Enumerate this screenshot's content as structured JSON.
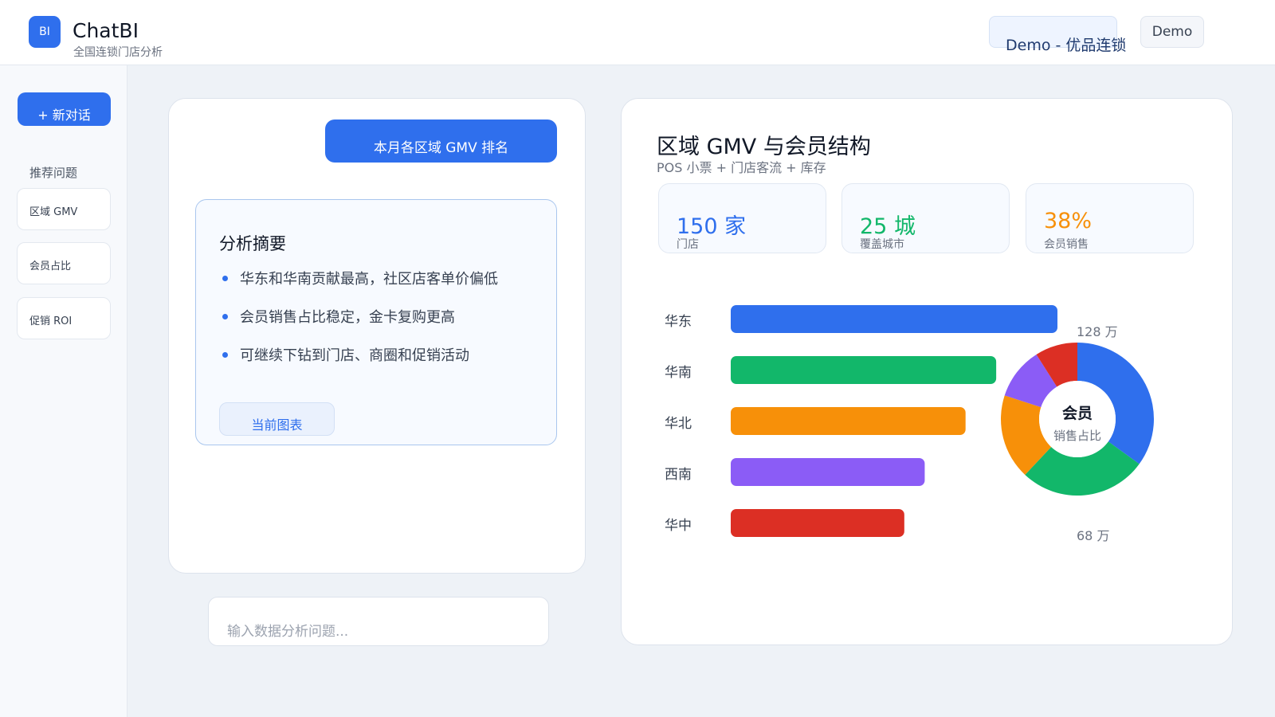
{
  "header": {
    "logo_text": "BI",
    "app_title": "ChatBI",
    "app_subtitle": "全国连锁门店分析",
    "tenant_label": "Demo - 优品连锁",
    "demo_button": "Demo"
  },
  "sidebar": {
    "new_chat_label": "+ 新对话",
    "section_label": "推荐问题",
    "items": [
      {
        "label": "区域 GMV"
      },
      {
        "label": "会员占比"
      },
      {
        "label": "促销 ROI"
      }
    ]
  },
  "chat": {
    "user_message": "本月各区域 GMV 排名",
    "summary_title": "分析摘要",
    "summary_items": [
      "华东和华南贡献最高，社区店客单价偏低",
      "会员销售占比稳定，金卡复购更高",
      "可继续下钻到门店、商圈和促销活动"
    ],
    "chart_pill_label": "当前图表",
    "input_placeholder": "输入数据分析问题..."
  },
  "analysis": {
    "title": "区域 GMV 与会员结构",
    "subtitle": "POS 小票 + 门店客流 + 库存",
    "kpis": [
      {
        "value": "150 家",
        "label": "门店",
        "color": "#2f6fed"
      },
      {
        "value": "25 城",
        "label": "覆盖城市",
        "color": "#12b76a"
      },
      {
        "value": "38%",
        "label": "会员销售",
        "color": "#f79009"
      }
    ]
  },
  "chart_data": [
    {
      "type": "bar",
      "orientation": "horizontal",
      "categories": [
        "华东",
        "华南",
        "华北",
        "西南",
        "华中"
      ],
      "values": [
        128,
        104,
        92,
        76,
        68
      ],
      "unit": "万",
      "value_labels": [
        "128 万",
        "68 万"
      ],
      "colors": [
        "#2f6fed",
        "#12b76a",
        "#f79009",
        "#8b5cf6",
        "#dc2f24"
      ]
    },
    {
      "type": "pie",
      "variant": "donut",
      "center_title": "会员",
      "center_subtitle": "销售占比",
      "slices": [
        {
          "value": 35,
          "color": "#2f6fed"
        },
        {
          "value": 27,
          "color": "#12b76a"
        },
        {
          "value": 18,
          "color": "#f79009"
        },
        {
          "value": 11,
          "color": "#8b5cf6"
        },
        {
          "value": 9,
          "color": "#dc2f24"
        }
      ]
    }
  ]
}
